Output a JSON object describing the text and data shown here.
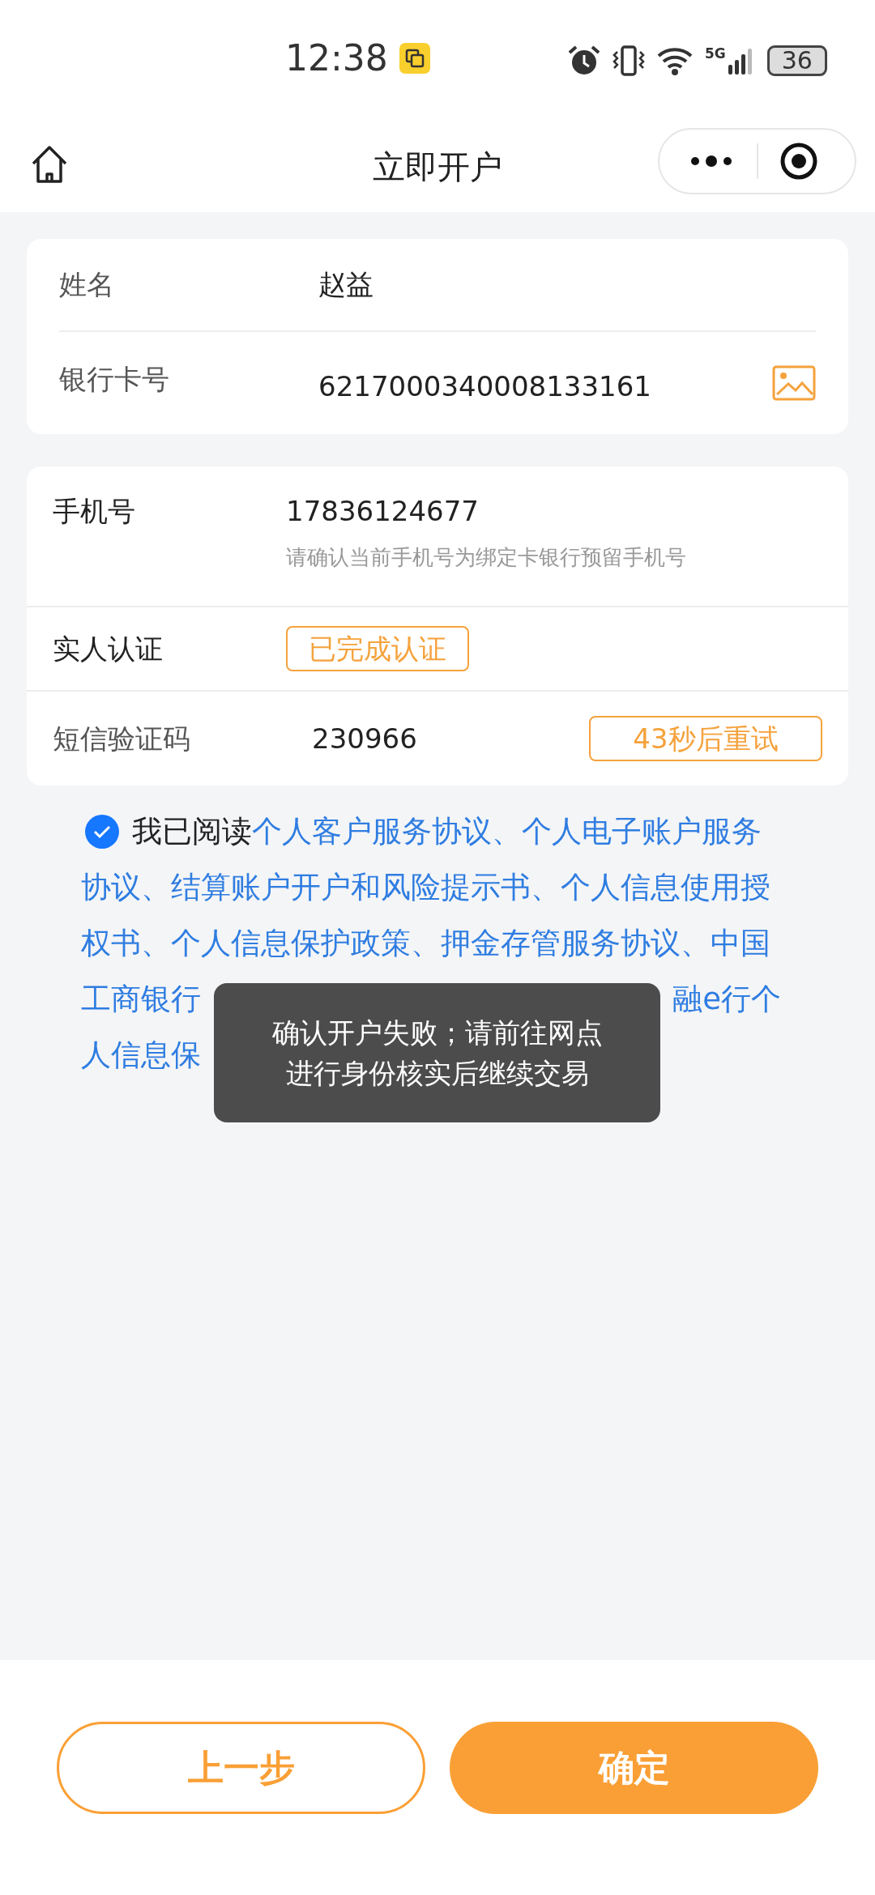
{
  "status_bar": {
    "time": "12:38",
    "signal_label": "5G",
    "battery": "36"
  },
  "nav": {
    "title": "立即开户"
  },
  "card_info": [
    {
      "label": "姓名",
      "value": "赵益",
      "kind": "text"
    },
    {
      "label": "银行卡号",
      "value": "6217000340008133161",
      "kind": "image"
    }
  ],
  "card_verify": {
    "phone": {
      "label": "手机号",
      "value": "17836124677",
      "hint": "请确认当前手机号为绑定卡银行预留手机号"
    },
    "face": {
      "label": "实人认证",
      "badge": "已完成认证"
    },
    "sms": {
      "label": "短信验证码",
      "value": "230966",
      "button": "43秒后重试"
    }
  },
  "agreement": {
    "checked": true,
    "prefix": "我已阅读",
    "line1_link": "个人客户服务协议、个人电子账户服务",
    "links": "协议、结算账户开户和风险提示书、个人信息使用授权书、个人信息保护政策、押金存管服务协议、中国",
    "line4_left": "工商银行",
    "line4_right": "融e行个",
    "line5_left": "人信息保"
  },
  "toast": [
    "确认开户失败；请前往网点",
    "进行身份核实后继续交易"
  ],
  "buttons": {
    "back": "上一步",
    "confirm": "确定"
  }
}
